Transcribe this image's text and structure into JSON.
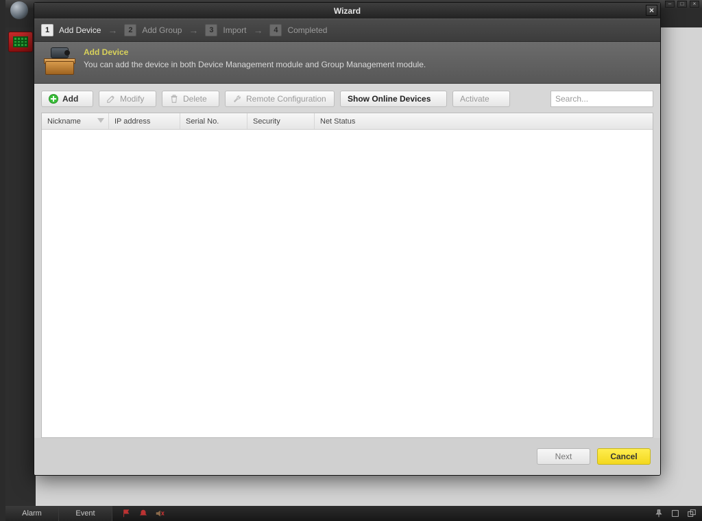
{
  "outer": {
    "bottom_tabs": [
      "Alarm",
      "Event"
    ]
  },
  "dialog": {
    "title": "Wizard",
    "steps": [
      {
        "num": "1",
        "label": "Add Device",
        "active": true
      },
      {
        "num": "2",
        "label": "Add Group",
        "active": false
      },
      {
        "num": "3",
        "label": "Import",
        "active": false
      },
      {
        "num": "4",
        "label": "Completed",
        "active": false
      }
    ],
    "banner": {
      "title": "Add Device",
      "desc": "You can add the device in both Device Management module and Group Management module."
    },
    "toolbar": {
      "add": "Add",
      "modify": "Modify",
      "delete": "Delete",
      "remote": "Remote Configuration",
      "show_online": "Show Online Devices",
      "activate": "Activate"
    },
    "search": {
      "placeholder": "Search..."
    },
    "grid": {
      "columns": {
        "nickname": "Nickname",
        "ip": "IP address",
        "serial": "Serial No.",
        "security": "Security",
        "netstatus": "Net Status"
      },
      "rows": []
    },
    "footer": {
      "next": "Next",
      "cancel": "Cancel"
    }
  }
}
